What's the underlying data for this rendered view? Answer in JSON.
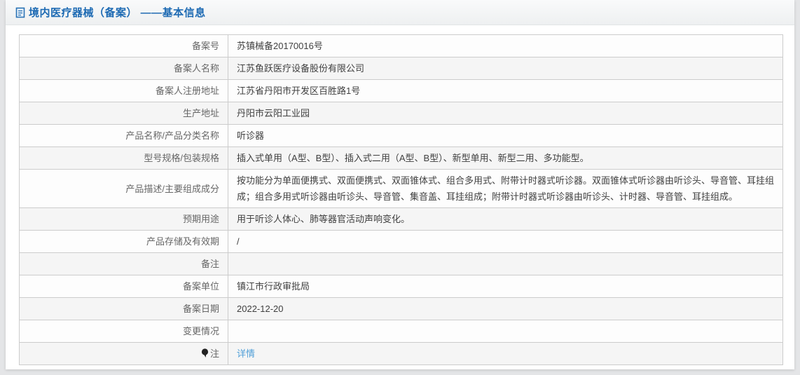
{
  "header": {
    "title": "境内医疗器械（备案） ——基本信息",
    "icon": "document-icon",
    "title_color": "#1d6ab3"
  },
  "table": {
    "rows": [
      {
        "label": "备案号",
        "value": "苏镇械备20170016号"
      },
      {
        "label": "备案人名称",
        "value": "江苏鱼跃医疗设备股份有限公司"
      },
      {
        "label": "备案人注册地址",
        "value": "江苏省丹阳市开发区百胜路1号"
      },
      {
        "label": "生产地址",
        "value": "丹阳市云阳工业园"
      },
      {
        "label": "产品名称/产品分类名称",
        "value": "听诊器"
      },
      {
        "label": "型号规格/包装规格",
        "value": "插入式单用（A型、B型）、插入式二用（A型、B型）、新型单用、新型二用、多功能型。"
      },
      {
        "label": "产品描述/主要组成成分",
        "value": "按功能分为单面便携式、双面便携式、双面锥体式、组合多用式、附带计时器式听诊器。双面锥体式听诊器由听诊头、导音管、耳挂组成；组合多用式听诊器由听诊头、导音管、集音盖、耳挂组成；附带计时器式听诊器由听诊头、计时器、导音管、耳挂组成。"
      },
      {
        "label": "预期用途",
        "value": "用于听诊人体心、肺等器官活动声响变化。"
      },
      {
        "label": "产品存储及有效期",
        "value": "/"
      },
      {
        "label": "备注",
        "value": ""
      },
      {
        "label": "备案单位",
        "value": "镇江市行政审批局"
      },
      {
        "label": "备案日期",
        "value": "2022-12-20"
      },
      {
        "label": "变更情况",
        "value": ""
      },
      {
        "label": "注",
        "value": "详情",
        "label_icon": "note-pin-icon",
        "value_is_link": true
      }
    ]
  },
  "colors": {
    "page_bg": "#e4e5e7",
    "card_bg": "#ffffff",
    "header_band": "#eef0f1",
    "table_border": "#cccccc",
    "zebra_row": "#f5f5f5",
    "label_text": "#666666",
    "value_text": "#404040",
    "title_blue": "#1d6ab3",
    "link_blue": "#4f9fd8"
  }
}
